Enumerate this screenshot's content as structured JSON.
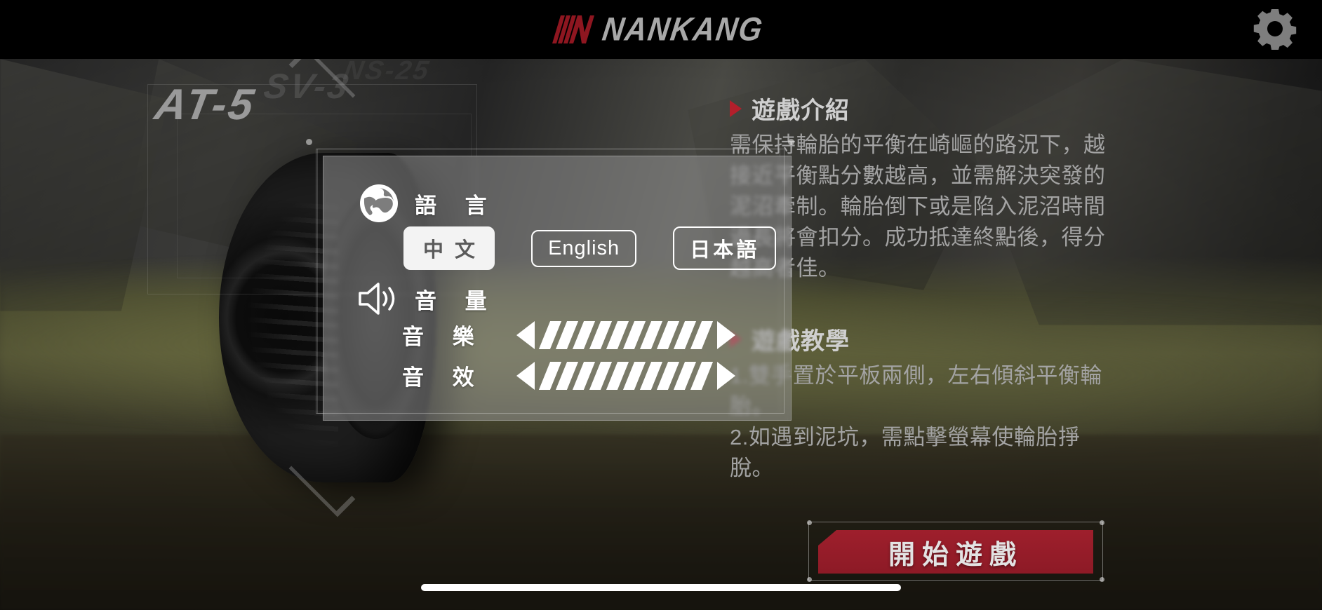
{
  "header": {
    "brand_mark": "nankang-n-logo",
    "brand_name": "NANKANG",
    "settings_icon": "gear-icon",
    "logo_red": "#8E1620",
    "logo_gray": "#A8A8A8"
  },
  "tire_models": {
    "front": "AT-5",
    "middle": "SV-3",
    "back": "NS-25"
  },
  "info": {
    "intro": {
      "marker": "red-triangle-icon",
      "title": "遊戲介紹",
      "body": "需保持輪胎的平衡在崎嶇的路況下，越接近平衡點分數越高，並需解決突發的泥沼牽制。輪胎倒下或是陷入泥沼時間過長將會扣分。成功抵達終點後，得分越高者佳。"
    },
    "tutorial": {
      "marker": "red-triangle-icon",
      "title": "遊戲教學",
      "steps": [
        "1.雙手置於平板兩側，左右傾斜平衡輪胎。",
        "2.如遇到泥坑，需點擊螢幕使輪胎掙脫。"
      ]
    }
  },
  "settings": {
    "language": {
      "icon": "globe-icon",
      "label": "語 言",
      "options": [
        {
          "label": "中 文",
          "selected": true
        },
        {
          "label": "English",
          "selected": false
        },
        {
          "label": "日本語",
          "selected": false
        }
      ]
    },
    "volume": {
      "icon": "speaker-icon",
      "label": "音 量",
      "music": {
        "label": "音 樂",
        "decrease_icon": "left-triangle-icon",
        "increase_icon": "right-triangle-icon",
        "level": 10,
        "max": 10
      },
      "sfx": {
        "label": "音 效",
        "decrease_icon": "left-triangle-icon",
        "increase_icon": "right-triangle-icon",
        "level": 10,
        "max": 10
      }
    }
  },
  "start_button": {
    "label": "開始遊戲",
    "color": "#8D1A26"
  },
  "system": {
    "home_indicator": "home-indicator-bar"
  }
}
